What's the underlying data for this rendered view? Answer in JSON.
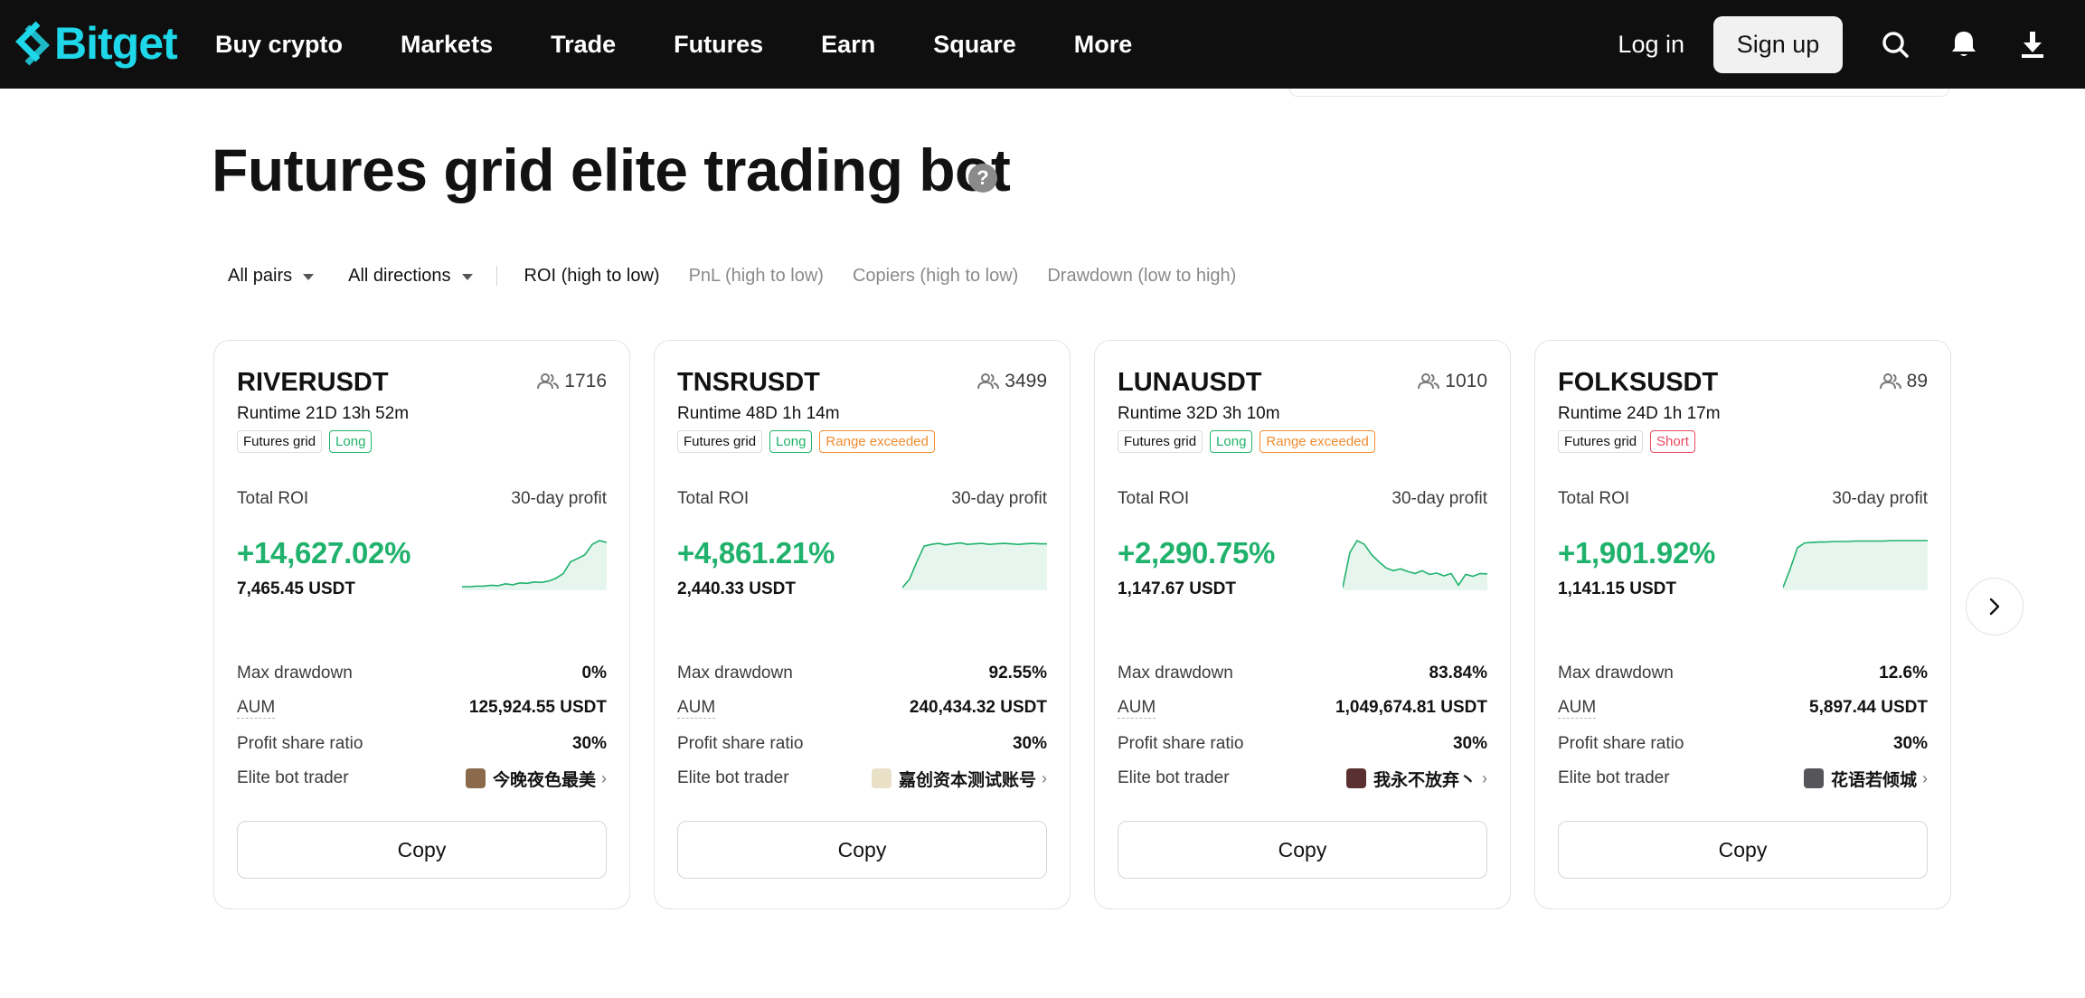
{
  "nav": {
    "brand": "Bitget",
    "links": [
      "Buy crypto",
      "Markets",
      "Trade",
      "Futures",
      "Earn",
      "Square",
      "More"
    ],
    "login": "Log in",
    "signup": "Sign up",
    "icons": [
      "search-icon",
      "bell-icon",
      "download-icon"
    ]
  },
  "page": {
    "title": "Futures grid elite trading bot",
    "help": "?"
  },
  "filters": {
    "pairs": "All pairs",
    "directions": "All directions",
    "sorts": [
      "ROI (high to low)",
      "PnL (high to low)",
      "Copiers (high to low)",
      "Drawdown (low to high)"
    ],
    "active_sort": "ROI (high to low)"
  },
  "labels": {
    "runtime": "Runtime",
    "total_roi": "Total ROI",
    "profit_30d": "30-day profit",
    "max_drawdown": "Max drawdown",
    "aum": "AUM",
    "profit_share": "Profit share ratio",
    "elite_trader": "Elite bot trader",
    "copy": "Copy"
  },
  "colors": {
    "profit_green": "#20b26c",
    "brand_cyan": "#1ed7e8",
    "long_tag": "#20b26c",
    "short_tag": "#e84a5f",
    "range_tag": "#f08c2e"
  },
  "cards": [
    {
      "pair": "RIVERUSDT",
      "copiers": "1716",
      "runtime": "21D 13h 52m",
      "tags": [
        {
          "text": "Futures grid",
          "kind": "plain"
        },
        {
          "text": "Long",
          "kind": "long"
        }
      ],
      "roi": "+14,627.02%",
      "pnl": "7,465.45 USDT",
      "max_drawdown": "0%",
      "aum": "125,924.55 USDT",
      "profit_share": "30%",
      "trader": "今晚夜色最美",
      "avatar_color": "#8a6a4a",
      "spark": [
        0.02,
        0.02,
        0.03,
        0.03,
        0.05,
        0.04,
        0.08,
        0.06,
        0.1,
        0.09,
        0.12,
        0.11,
        0.14,
        0.2,
        0.3,
        0.55,
        0.62,
        0.7,
        0.92,
        1.0,
        0.96
      ]
    },
    {
      "pair": "TNSRUSDT",
      "copiers": "3499",
      "runtime": "48D 1h 14m",
      "tags": [
        {
          "text": "Futures grid",
          "kind": "plain"
        },
        {
          "text": "Long",
          "kind": "long"
        },
        {
          "text": "Range exceeded",
          "kind": "range"
        }
      ],
      "roi": "+4,861.21%",
      "pnl": "2,440.33 USDT",
      "max_drawdown": "92.55%",
      "aum": "240,434.32 USDT",
      "profit_share": "30%",
      "trader": "嘉创资本测试账号",
      "avatar_color": "#e9e0c8",
      "spark": [
        0.0,
        0.18,
        0.55,
        0.88,
        0.92,
        0.94,
        0.91,
        0.93,
        0.95,
        0.92,
        0.93,
        0.94,
        0.92,
        0.93,
        0.94,
        0.93,
        0.92,
        0.93,
        0.94,
        0.93,
        0.93
      ]
    },
    {
      "pair": "LUNAUSDT",
      "copiers": "1010",
      "runtime": "32D 3h 10m",
      "tags": [
        {
          "text": "Futures grid",
          "kind": "plain"
        },
        {
          "text": "Long",
          "kind": "long"
        },
        {
          "text": "Range exceeded",
          "kind": "range"
        }
      ],
      "roi": "+2,290.75%",
      "pnl": "1,147.67 USDT",
      "max_drawdown": "83.84%",
      "aum": "1,049,674.81 USDT",
      "profit_share": "30%",
      "trader": "我永不放弃丶",
      "avatar_color": "#5a3030",
      "spark": [
        0.0,
        0.75,
        1.0,
        0.92,
        0.7,
        0.55,
        0.42,
        0.36,
        0.4,
        0.34,
        0.3,
        0.36,
        0.28,
        0.31,
        0.25,
        0.3,
        0.05,
        0.28,
        0.24,
        0.3,
        0.29
      ]
    },
    {
      "pair": "FOLKSUSDT",
      "copiers": "89",
      "runtime": "24D 1h 17m",
      "tags": [
        {
          "text": "Futures grid",
          "kind": "plain"
        },
        {
          "text": "Short",
          "kind": "short"
        }
      ],
      "roi": "+1,901.92%",
      "pnl": "1,141.15 USDT",
      "max_drawdown": "12.6%",
      "aum": "5,897.44 USDT",
      "profit_share": "30%",
      "trader": "花语若倾城",
      "avatar_color": "#55555a",
      "spark": [
        0.0,
        0.4,
        0.85,
        0.95,
        0.96,
        0.97,
        0.97,
        0.98,
        0.98,
        0.98,
        0.99,
        0.99,
        0.99,
        0.99,
        0.99,
        1.0,
        1.0,
        1.0,
        1.0,
        1.0,
        1.0
      ]
    }
  ]
}
